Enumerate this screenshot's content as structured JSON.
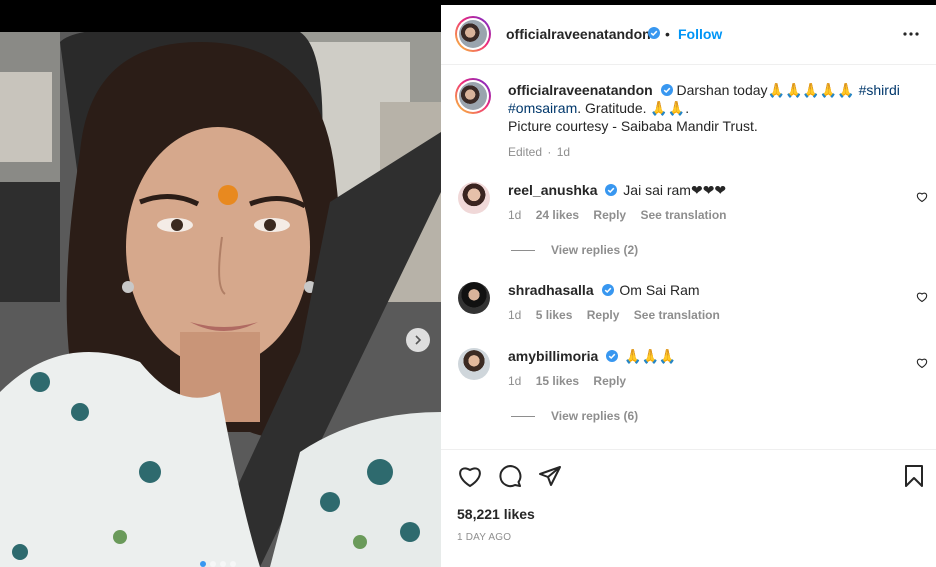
{
  "post": {
    "author": "officialraveenatandon",
    "follow_label": "Follow",
    "caption_text": "Darshan today",
    "caption_emojis": "🙏🙏🙏🙏🙏",
    "caption_tags": [
      "#shirdi",
      "#omsairam"
    ],
    "caption_line2": ". Gratitude. ",
    "caption_line2_emojis": "🙏🙏.",
    "caption_line3": "Picture courtesy - Saibaba Mandir Trust.",
    "edited_label": "Edited",
    "edited_sep": "·",
    "edited_time": "1d"
  },
  "comments": [
    {
      "username": "reel_anushka",
      "verified": true,
      "text": "Jai sai ram❤❤❤",
      "time": "1d",
      "likes": "24 likes",
      "reply": "Reply",
      "translate": "See translation",
      "view_replies": "View replies (2)"
    },
    {
      "username": "shradhasalla",
      "verified": true,
      "text": "Om Sai Ram",
      "time": "1d",
      "likes": "5 likes",
      "reply": "Reply",
      "translate": "See translation",
      "view_replies": ""
    },
    {
      "username": "amybillimoria",
      "verified": true,
      "text": "🙏🙏🙏",
      "time": "1d",
      "likes": "15 likes",
      "reply": "Reply",
      "translate": "",
      "view_replies": "View replies (6)"
    }
  ],
  "footer": {
    "likes": "58,221 likes",
    "posted": "1 DAY AGO"
  },
  "icons": [
    "more-icon",
    "verified-icon",
    "heart-icon",
    "comment-icon",
    "share-icon",
    "bookmark-icon",
    "chevron-right-icon"
  ],
  "colors": {
    "follow": "#0095f6",
    "hashtag": "#00376b",
    "meta": "#8e8e8e",
    "verified": "#3897f0"
  }
}
